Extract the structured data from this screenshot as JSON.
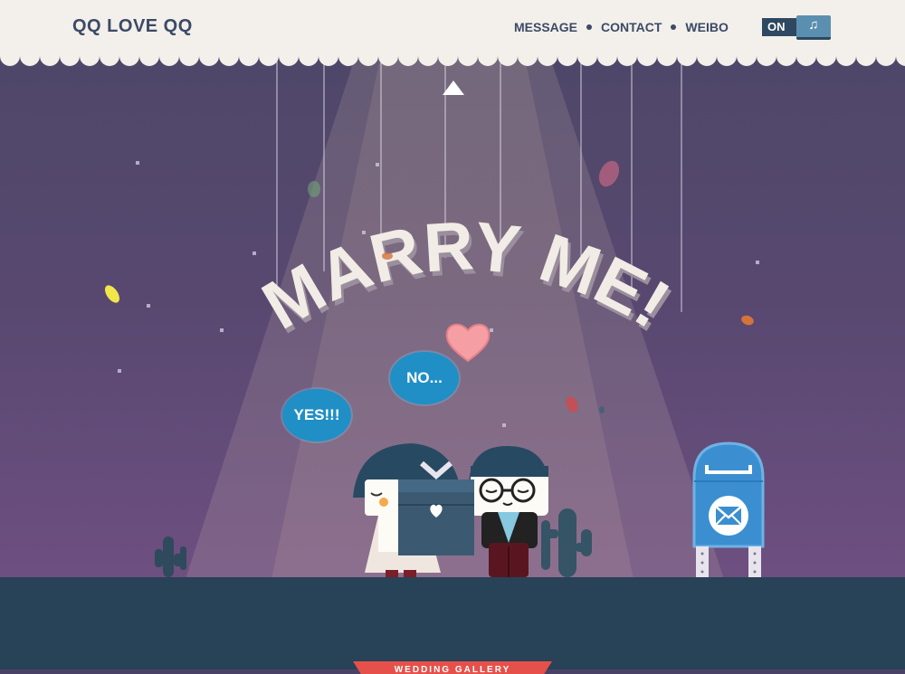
{
  "header": {
    "logo": "QQ LOVE QQ",
    "nav": [
      {
        "label": "MESSAGE"
      },
      {
        "label": "CONTACT"
      },
      {
        "label": "WEIBO"
      }
    ],
    "music_toggle": {
      "state": "ON",
      "icon": "music-note-icon"
    }
  },
  "scene": {
    "headline": "MARRY ME!",
    "answers": {
      "yes": "YES!!!",
      "no": "NO..."
    },
    "mailbox_icon": "envelope-icon"
  },
  "footer_ribbon": {
    "label": "WEDDING GALLERY"
  },
  "colors": {
    "header_bg": "#f3efea",
    "nav_text": "#3b4a66",
    "bubble": "#1f8fc6",
    "ground": "#284257",
    "ribbon": "#e6504a",
    "mailbox": "#3b8fd0",
    "heart": "#f59ea4"
  }
}
